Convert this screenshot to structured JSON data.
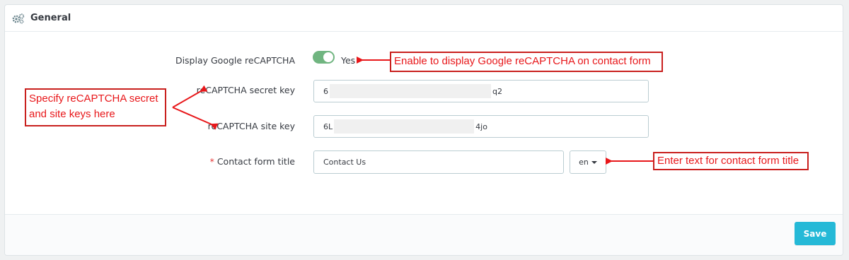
{
  "panel": {
    "title": "General",
    "icon": "gears-icon"
  },
  "fields": {
    "display_recaptcha": {
      "label": "Display Google reCAPTCHA",
      "value": "Yes",
      "enabled": true
    },
    "secret_key": {
      "label": "reCAPTCHA secret key",
      "value_start": "6",
      "value_end": "q2"
    },
    "site_key": {
      "label": "reCAPTCHA site key",
      "value_start": "6L",
      "value_end": "4jo"
    },
    "contact_title": {
      "required_mark": "*",
      "label": "Contact form title",
      "value": "Contact Us",
      "language": "en"
    }
  },
  "footer": {
    "save_label": "Save"
  },
  "annotations": {
    "enable": "Enable to display Google reCAPTCHA on contact form",
    "keys_line1": "Specify reCAPTCHA secret",
    "keys_line2": "and site keys here",
    "title": "Enter text for contact form title"
  },
  "colors": {
    "accent": "#25b9d7",
    "toggle_on": "#70b580",
    "annotation": "#e8171a"
  }
}
